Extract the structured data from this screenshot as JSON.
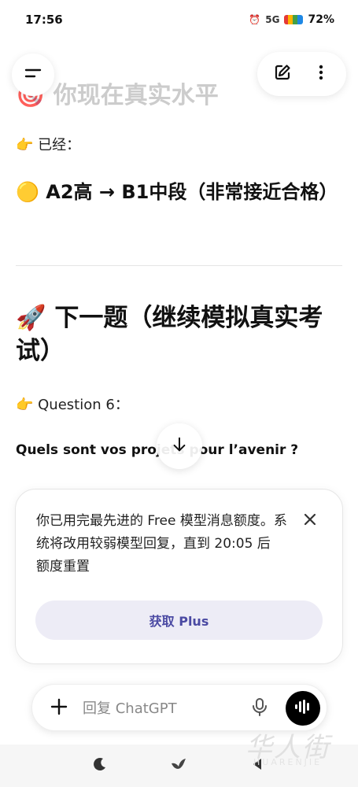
{
  "status_bar": {
    "time": "17:56",
    "signal": "5G",
    "battery": "72%"
  },
  "top_bar": {
    "menu_icon": "menu-icon",
    "new_chat_icon": "edit-icon",
    "more_icon": "more-vertical-icon"
  },
  "chat": {
    "partial_heading": "🎯 你现在真实水平",
    "para1": "👉 已经：",
    "level_heading": "🟡 A2高 → B1中段（非常接近合格）",
    "next_heading": "🚀 下一题（继续模拟真实考试）",
    "question_label": "👉 Question 6：",
    "question_text": "Quels sont vos projets pour l’avenir ?"
  },
  "notice": {
    "text": "你已用完最先进的 Free 模型消息额度。系统将改用较弱模型回复，直到 20:05 后 额度重置",
    "button_label": "获取 Plus",
    "close_icon": "close-icon"
  },
  "composer": {
    "placeholder": "回复 ChatGPT",
    "add_icon": "plus-icon",
    "mic_icon": "microphone-icon",
    "voice_icon": "voice-mode-icon"
  },
  "bottom_nav": {
    "items": [
      "moon-icon",
      "bird-icon",
      "back-icon"
    ]
  },
  "watermark": {
    "chinese": "华人街",
    "english": "HUARENJIE"
  },
  "colors": {
    "accent": "#4b4aa3",
    "button_bg": "#edecf6",
    "voice_bg": "#000000"
  }
}
